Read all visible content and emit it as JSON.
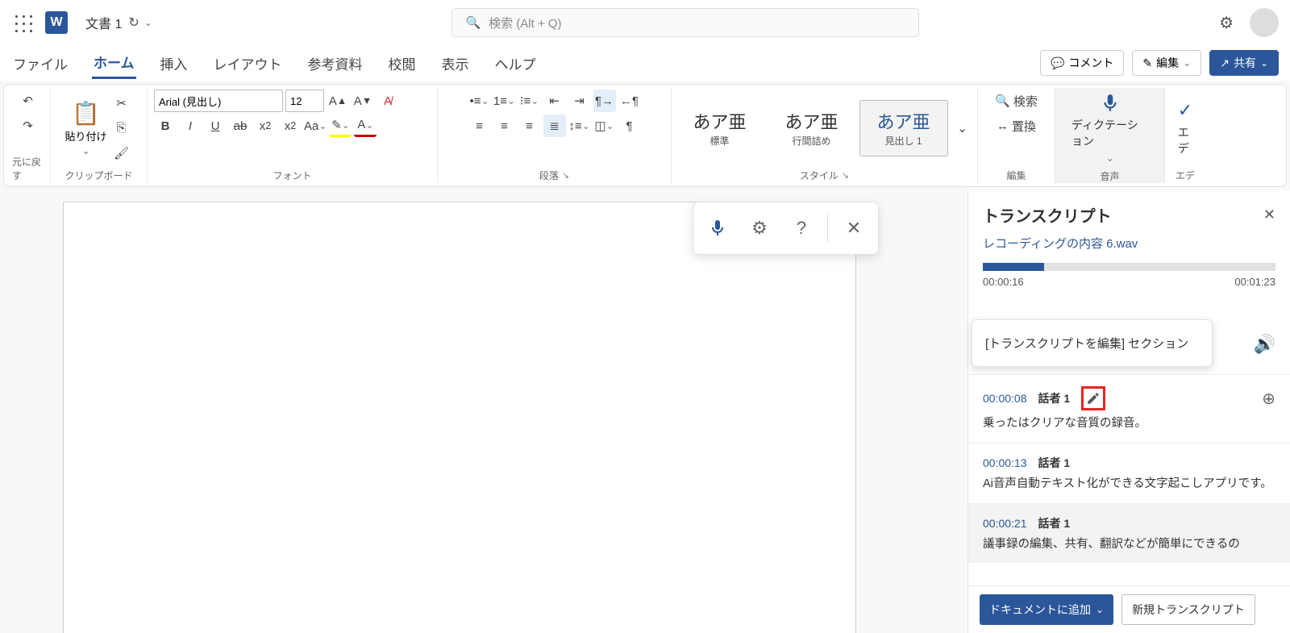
{
  "titlebar": {
    "doc_name": "文書 1",
    "search_placeholder": "検索 (Alt + Q)"
  },
  "tabs": {
    "items": [
      "ファイル",
      "ホーム",
      "挿入",
      "レイアウト",
      "参考資料",
      "校閲",
      "表示",
      "ヘルプ"
    ],
    "active_index": 1,
    "comments": "コメント",
    "editing": "編集",
    "share": "共有"
  },
  "ribbon": {
    "undo_label": "元に戻す",
    "clipboard": {
      "paste": "貼り付け",
      "label": "クリップボード"
    },
    "font": {
      "name": "Arial (見出し)",
      "size": "12",
      "label": "フォント"
    },
    "paragraph": {
      "label": "段落"
    },
    "styles": {
      "items": [
        {
          "big": "あア亜",
          "small": "標準"
        },
        {
          "big": "あア亜",
          "small": "行間詰め"
        },
        {
          "big": "あア亜",
          "small": "見出し 1"
        }
      ],
      "label": "スタイル"
    },
    "editing": {
      "find": "検索",
      "replace": "置換",
      "label": "編集"
    },
    "voice": {
      "dictation": "ディクテーション",
      "label": "音声"
    },
    "editor": {
      "btn": "エデ",
      "label": "エデ"
    }
  },
  "sidepanel": {
    "title": "トランスクリプト",
    "file_prefix": "レコーディングの内容 ",
    "file_name": "6.wav",
    "current_time": "00:00:16",
    "total_time": "00:01:23",
    "tooltip": "[トランスクリプトを編集] セクション",
    "segments": [
      {
        "time": "00:00:08",
        "speaker": "話者 1",
        "text": "乗ったはクリアな音質の録音。",
        "edit": true,
        "plus": true
      },
      {
        "time": "00:00:13",
        "speaker": "話者 1",
        "text": "Ai音声自動テキスト化ができる文字起こしアプリです。"
      },
      {
        "time": "00:00:21",
        "speaker": "話者 1",
        "text": "議事録の編集、共有、翻訳などが簡単にできるの",
        "active": true
      }
    ],
    "footer": {
      "add": "ドキュメントに追加",
      "newt": "新規トランスクリプト"
    }
  }
}
